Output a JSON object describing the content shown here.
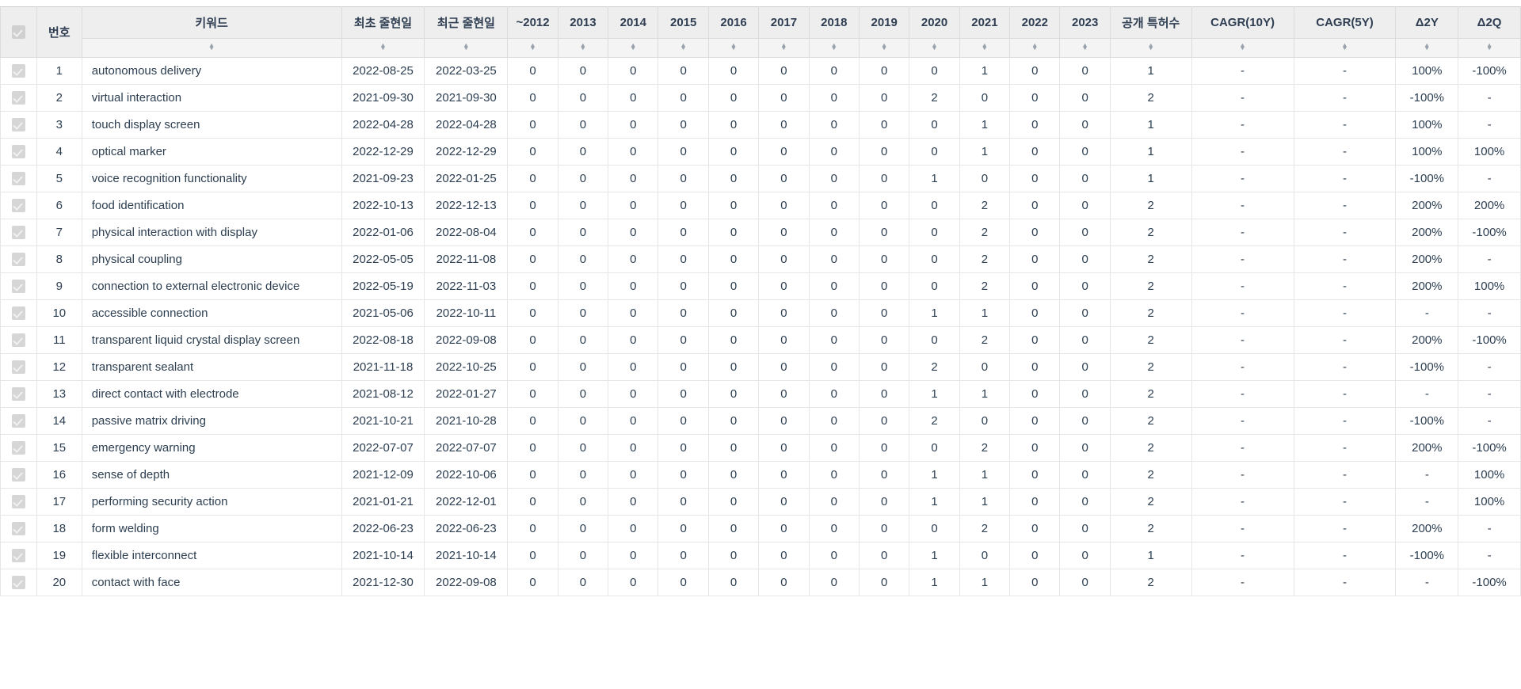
{
  "table": {
    "columns": [
      {
        "key": "check",
        "label": "",
        "type": "check"
      },
      {
        "key": "no",
        "label": "번호",
        "type": "no"
      },
      {
        "key": "kw",
        "label": "키워드",
        "type": "kw"
      },
      {
        "key": "first",
        "label": "최초 줄현일",
        "type": "date"
      },
      {
        "key": "last",
        "label": "최근 줄현일",
        "type": "date"
      },
      {
        "key": "y2012",
        "label": "~2012",
        "type": "year"
      },
      {
        "key": "y2013",
        "label": "2013",
        "type": "year"
      },
      {
        "key": "y2014",
        "label": "2014",
        "type": "year"
      },
      {
        "key": "y2015",
        "label": "2015",
        "type": "year"
      },
      {
        "key": "y2016",
        "label": "2016",
        "type": "year"
      },
      {
        "key": "y2017",
        "label": "2017",
        "type": "year"
      },
      {
        "key": "y2018",
        "label": "2018",
        "type": "year"
      },
      {
        "key": "y2019",
        "label": "2019",
        "type": "year"
      },
      {
        "key": "y2020",
        "label": "2020",
        "type": "year"
      },
      {
        "key": "y2021",
        "label": "2021",
        "type": "year"
      },
      {
        "key": "y2022",
        "label": "2022",
        "type": "year"
      },
      {
        "key": "y2023",
        "label": "2023",
        "type": "year"
      },
      {
        "key": "total",
        "label": "공개 특허수",
        "type": "total"
      },
      {
        "key": "cagr10",
        "label": "CAGR(10Y)",
        "type": "cagr"
      },
      {
        "key": "cagr5",
        "label": "CAGR(5Y)",
        "type": "cagr"
      },
      {
        "key": "d2y",
        "label": "Δ2Y",
        "type": "delta"
      },
      {
        "key": "d2q",
        "label": "Δ2Q",
        "type": "delta"
      }
    ],
    "sort_icon": "sort-updown-icon",
    "header_checkbox": "select-all-checkbox",
    "row_checkbox": "row-select-checkbox",
    "rows": [
      {
        "no": "1",
        "kw": "autonomous delivery",
        "first": "2022-08-25",
        "last": "2022-03-25",
        "years": [
          "0",
          "0",
          "0",
          "0",
          "0",
          "0",
          "0",
          "0",
          "0",
          "1",
          "0"
        ],
        "y2023": "0",
        "total": "1",
        "cagr10": "-",
        "cagr5": "-",
        "d2y": "100%",
        "d2q": "-100%"
      },
      {
        "no": "2",
        "kw": "virtual interaction",
        "first": "2021-09-30",
        "last": "2021-09-30",
        "years": [
          "0",
          "0",
          "0",
          "0",
          "0",
          "0",
          "0",
          "0",
          "2",
          "0",
          "0"
        ],
        "y2023": "0",
        "total": "2",
        "cagr10": "-",
        "cagr5": "-",
        "d2y": "-100%",
        "d2q": "-"
      },
      {
        "no": "3",
        "kw": "touch display screen",
        "first": "2022-04-28",
        "last": "2022-04-28",
        "years": [
          "0",
          "0",
          "0",
          "0",
          "0",
          "0",
          "0",
          "0",
          "0",
          "1",
          "0"
        ],
        "y2023": "0",
        "total": "1",
        "cagr10": "-",
        "cagr5": "-",
        "d2y": "100%",
        "d2q": "-"
      },
      {
        "no": "4",
        "kw": "optical marker",
        "first": "2022-12-29",
        "last": "2022-12-29",
        "years": [
          "0",
          "0",
          "0",
          "0",
          "0",
          "0",
          "0",
          "0",
          "0",
          "1",
          "0"
        ],
        "y2023": "0",
        "total": "1",
        "cagr10": "-",
        "cagr5": "-",
        "d2y": "100%",
        "d2q": "100%"
      },
      {
        "no": "5",
        "kw": "voice recognition functionality",
        "first": "2021-09-23",
        "last": "2022-01-25",
        "years": [
          "0",
          "0",
          "0",
          "0",
          "0",
          "0",
          "0",
          "0",
          "1",
          "0",
          "0"
        ],
        "y2023": "0",
        "total": "1",
        "cagr10": "-",
        "cagr5": "-",
        "d2y": "-100%",
        "d2q": "-"
      },
      {
        "no": "6",
        "kw": "food identification",
        "first": "2022-10-13",
        "last": "2022-12-13",
        "years": [
          "0",
          "0",
          "0",
          "0",
          "0",
          "0",
          "0",
          "0",
          "0",
          "2",
          "0"
        ],
        "y2023": "0",
        "total": "2",
        "cagr10": "-",
        "cagr5": "-",
        "d2y": "200%",
        "d2q": "200%"
      },
      {
        "no": "7",
        "kw": "physical interaction with display",
        "first": "2022-01-06",
        "last": "2022-08-04",
        "years": [
          "0",
          "0",
          "0",
          "0",
          "0",
          "0",
          "0",
          "0",
          "0",
          "2",
          "0"
        ],
        "y2023": "0",
        "total": "2",
        "cagr10": "-",
        "cagr5": "-",
        "d2y": "200%",
        "d2q": "-100%"
      },
      {
        "no": "8",
        "kw": "physical coupling",
        "first": "2022-05-05",
        "last": "2022-11-08",
        "years": [
          "0",
          "0",
          "0",
          "0",
          "0",
          "0",
          "0",
          "0",
          "0",
          "2",
          "0"
        ],
        "y2023": "0",
        "total": "2",
        "cagr10": "-",
        "cagr5": "-",
        "d2y": "200%",
        "d2q": "-"
      },
      {
        "no": "9",
        "kw": "connection to external electronic device",
        "first": "2022-05-19",
        "last": "2022-11-03",
        "years": [
          "0",
          "0",
          "0",
          "0",
          "0",
          "0",
          "0",
          "0",
          "0",
          "2",
          "0"
        ],
        "y2023": "0",
        "total": "2",
        "cagr10": "-",
        "cagr5": "-",
        "d2y": "200%",
        "d2q": "100%"
      },
      {
        "no": "10",
        "kw": "accessible connection",
        "first": "2021-05-06",
        "last": "2022-10-11",
        "years": [
          "0",
          "0",
          "0",
          "0",
          "0",
          "0",
          "0",
          "0",
          "1",
          "1",
          "0"
        ],
        "y2023": "0",
        "total": "2",
        "cagr10": "-",
        "cagr5": "-",
        "d2y": "-",
        "d2q": "-"
      },
      {
        "no": "11",
        "kw": "transparent liquid crystal display screen",
        "first": "2022-08-18",
        "last": "2022-09-08",
        "years": [
          "0",
          "0",
          "0",
          "0",
          "0",
          "0",
          "0",
          "0",
          "0",
          "2",
          "0"
        ],
        "y2023": "0",
        "total": "2",
        "cagr10": "-",
        "cagr5": "-",
        "d2y": "200%",
        "d2q": "-100%"
      },
      {
        "no": "12",
        "kw": "transparent sealant",
        "first": "2021-11-18",
        "last": "2022-10-25",
        "years": [
          "0",
          "0",
          "0",
          "0",
          "0",
          "0",
          "0",
          "0",
          "2",
          "0",
          "0"
        ],
        "y2023": "0",
        "total": "2",
        "cagr10": "-",
        "cagr5": "-",
        "d2y": "-100%",
        "d2q": "-"
      },
      {
        "no": "13",
        "kw": "direct contact with electrode",
        "first": "2021-08-12",
        "last": "2022-01-27",
        "years": [
          "0",
          "0",
          "0",
          "0",
          "0",
          "0",
          "0",
          "0",
          "1",
          "1",
          "0"
        ],
        "y2023": "0",
        "total": "2",
        "cagr10": "-",
        "cagr5": "-",
        "d2y": "-",
        "d2q": "-"
      },
      {
        "no": "14",
        "kw": "passive matrix driving",
        "first": "2021-10-21",
        "last": "2021-10-28",
        "years": [
          "0",
          "0",
          "0",
          "0",
          "0",
          "0",
          "0",
          "0",
          "2",
          "0",
          "0"
        ],
        "y2023": "0",
        "total": "2",
        "cagr10": "-",
        "cagr5": "-",
        "d2y": "-100%",
        "d2q": "-"
      },
      {
        "no": "15",
        "kw": "emergency warning",
        "first": "2022-07-07",
        "last": "2022-07-07",
        "years": [
          "0",
          "0",
          "0",
          "0",
          "0",
          "0",
          "0",
          "0",
          "0",
          "2",
          "0"
        ],
        "y2023": "0",
        "total": "2",
        "cagr10": "-",
        "cagr5": "-",
        "d2y": "200%",
        "d2q": "-100%"
      },
      {
        "no": "16",
        "kw": "sense of depth",
        "first": "2021-12-09",
        "last": "2022-10-06",
        "years": [
          "0",
          "0",
          "0",
          "0",
          "0",
          "0",
          "0",
          "0",
          "1",
          "1",
          "0"
        ],
        "y2023": "0",
        "total": "2",
        "cagr10": "-",
        "cagr5": "-",
        "d2y": "-",
        "d2q": "100%"
      },
      {
        "no": "17",
        "kw": "performing security action",
        "first": "2021-01-21",
        "last": "2022-12-01",
        "years": [
          "0",
          "0",
          "0",
          "0",
          "0",
          "0",
          "0",
          "0",
          "1",
          "1",
          "0"
        ],
        "y2023": "0",
        "total": "2",
        "cagr10": "-",
        "cagr5": "-",
        "d2y": "-",
        "d2q": "100%"
      },
      {
        "no": "18",
        "kw": "form welding",
        "first": "2022-06-23",
        "last": "2022-06-23",
        "years": [
          "0",
          "0",
          "0",
          "0",
          "0",
          "0",
          "0",
          "0",
          "0",
          "2",
          "0"
        ],
        "y2023": "0",
        "total": "2",
        "cagr10": "-",
        "cagr5": "-",
        "d2y": "200%",
        "d2q": "-"
      },
      {
        "no": "19",
        "kw": "flexible interconnect",
        "first": "2021-10-14",
        "last": "2021-10-14",
        "years": [
          "0",
          "0",
          "0",
          "0",
          "0",
          "0",
          "0",
          "0",
          "1",
          "0",
          "0"
        ],
        "y2023": "0",
        "total": "1",
        "cagr10": "-",
        "cagr5": "-",
        "d2y": "-100%",
        "d2q": "-"
      },
      {
        "no": "20",
        "kw": "contact with face",
        "first": "2021-12-30",
        "last": "2022-09-08",
        "years": [
          "0",
          "0",
          "0",
          "0",
          "0",
          "0",
          "0",
          "0",
          "1",
          "1",
          "0"
        ],
        "y2023": "0",
        "total": "2",
        "cagr10": "-",
        "cagr5": "-",
        "d2y": "-",
        "d2q": "-100%"
      }
    ]
  },
  "colors": {
    "header_bg": "#eeeeee",
    "sortrow_bg": "#f4f4f4",
    "text": "#2c3e50",
    "border": "#e6e6e6",
    "checkbox": "#d6d6d6"
  }
}
